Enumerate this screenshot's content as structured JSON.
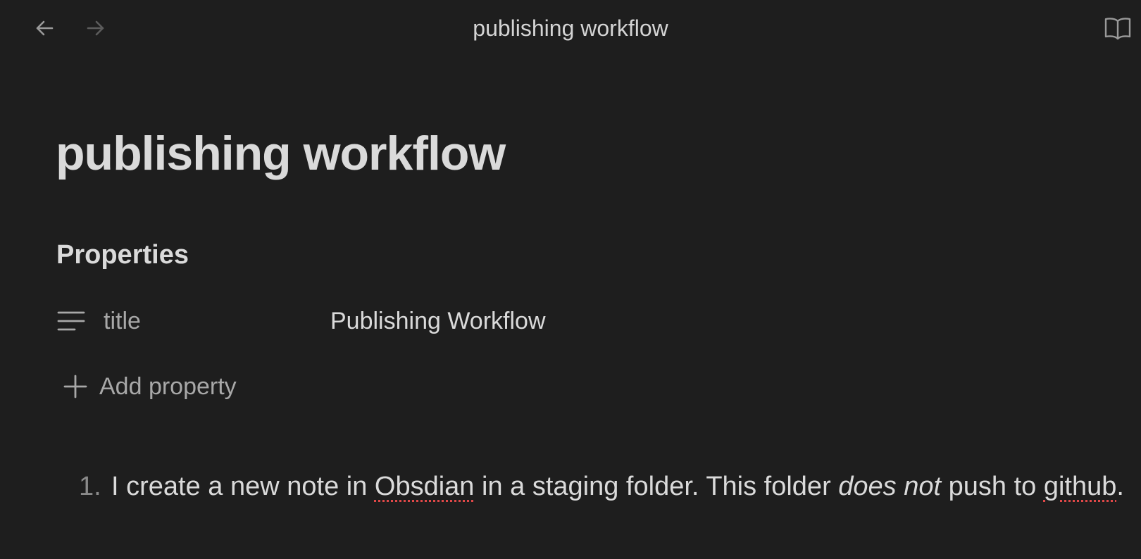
{
  "window": {
    "title": "publishing workflow"
  },
  "toolbar": {
    "back_icon": "arrow-left-icon",
    "forward_icon": "arrow-right-icon",
    "reading_view_icon": "open-book-icon"
  },
  "note": {
    "title": "publishing workflow",
    "properties": {
      "heading": "Properties",
      "items": [
        {
          "icon": "text-lines-icon",
          "key": "title",
          "value": "Publishing Workflow"
        }
      ],
      "add_label": "Add property"
    },
    "list": [
      {
        "number": "1.",
        "seg1": "I create a new note in ",
        "seg2": "Obsdian",
        "seg3": " in a staging folder. This folder ",
        "seg4": "does not",
        "seg5": " push to ",
        "seg6": "github",
        "seg7": "."
      }
    ]
  },
  "colors": {
    "background": "#1e1e1e",
    "text": "#dadada",
    "muted": "#a8a8a8",
    "spellcheck": "#e04848"
  }
}
